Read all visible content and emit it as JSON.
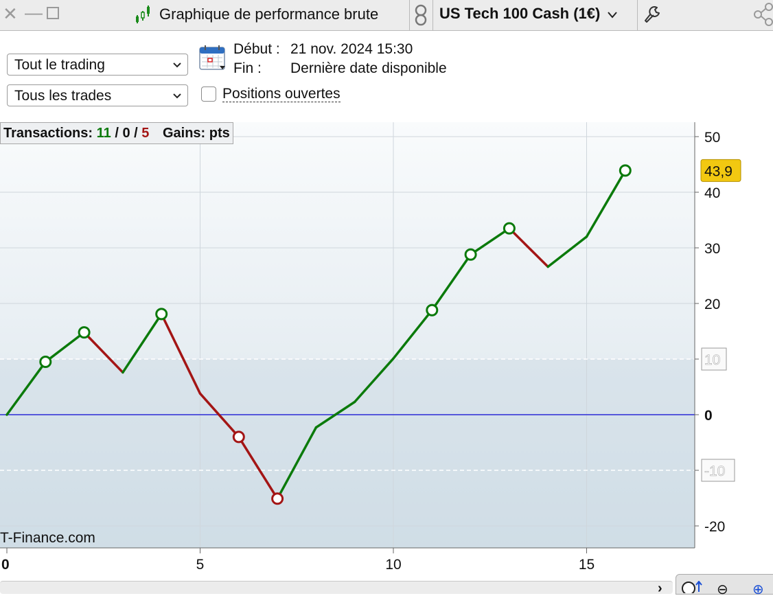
{
  "titlebar": {
    "close_glyph": "✕",
    "minimize_glyph": "—",
    "chart_title": "Graphique de performance brute",
    "instrument": "US Tech 100 Cash (1€)"
  },
  "filters": {
    "scope_selected": "Tout le trading",
    "trades_selected": "Tous les trades",
    "start_label": "Début :",
    "start_value": "21 nov. 2024 15:30",
    "end_label": "Fin :",
    "end_value": "Dernière date disponible",
    "open_positions_label": "Positions ouvertes",
    "open_positions_checked": false
  },
  "info": {
    "transactions_label": "Transactions:",
    "wins": "11",
    "sep1": "/",
    "neutral": "0",
    "sep2": "/",
    "losses": "5",
    "gains_label": "Gains: pts"
  },
  "watermark": "T-Finance.com",
  "colors": {
    "win": "#0b7a0b",
    "loss": "#a31515",
    "zero_line": "#2b2bd6",
    "last_badge": "#f2c811"
  },
  "chart_data": {
    "type": "line",
    "x": [
      0,
      1,
      2,
      3,
      4,
      5,
      6,
      7,
      8,
      9,
      10,
      11,
      12,
      13,
      14,
      15,
      16
    ],
    "y": [
      0,
      9.5,
      14.8,
      7.6,
      18.1,
      3.8,
      -4,
      -15.1,
      -2.3,
      2.3,
      10.1,
      18.8,
      28.8,
      33.5,
      26.6,
      32,
      43.9
    ],
    "markers": [
      1,
      2,
      4,
      6,
      7,
      11,
      12,
      13,
      16
    ],
    "last_value_label": "43,9",
    "xlim": [
      0,
      18
    ],
    "ylim": [
      -24,
      52
    ],
    "x_ticks": [
      "0",
      "5",
      "10",
      "15"
    ],
    "y_ticks": [
      "50",
      "40",
      "30",
      "20",
      "10",
      "0",
      "-10",
      "-20"
    ],
    "dashed_levels": [
      10,
      -10
    ],
    "grid": true
  },
  "controls": {
    "scroll_arrow": "›",
    "zoom_out": "⊖",
    "zoom_in": "⊕"
  }
}
